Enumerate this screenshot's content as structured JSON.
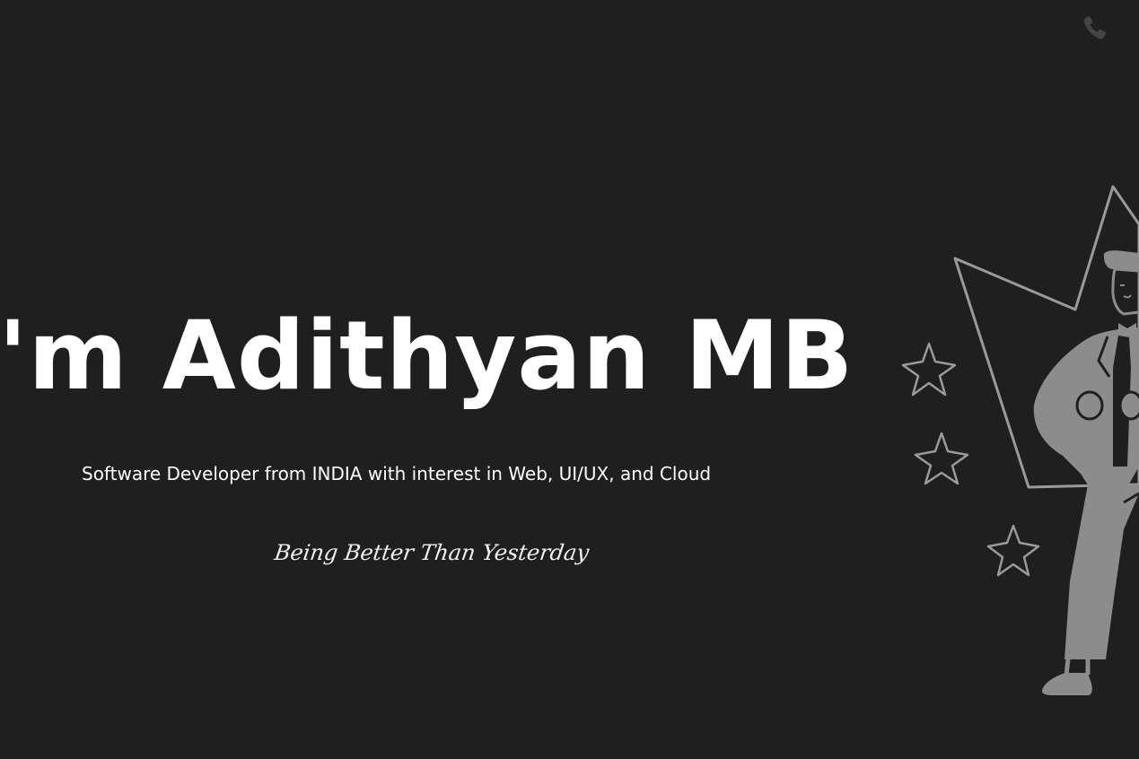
{
  "header": {
    "phone_icon": "phone-icon"
  },
  "hero": {
    "title": "'m Adithyan MB",
    "subtitle": "Software Developer from INDIA with interest in Web, UI/UX, and Cloud",
    "tagline": "Being Better Than Yesterday"
  },
  "illustration": {
    "icon": "character-with-stars-illustration"
  },
  "colors": {
    "background": "#1f1f1f",
    "text": "#ffffff",
    "illustration_gray": "#8c8c8c",
    "illustration_line": "#9a9a9a"
  }
}
